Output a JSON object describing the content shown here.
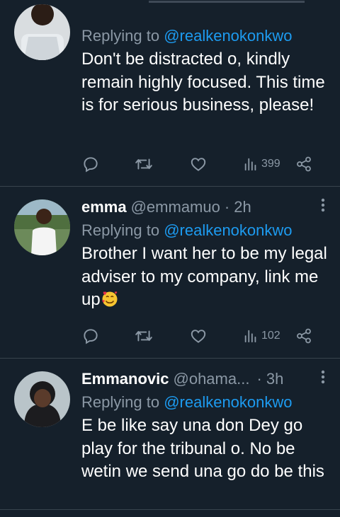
{
  "colors": {
    "background": "#15202b",
    "text_primary": "#ffffff",
    "text_secondary": "#8b98a5",
    "link": "#1d9bf0",
    "divider": "#38444d"
  },
  "tweets": [
    {
      "name": "",
      "handle": "",
      "time": "",
      "reply_prefix": "Replying to ",
      "reply_to": "@realkenokonkwo",
      "text": "Don't be distracted o, kindly remain highly focused. This time is for serious business, please!",
      "views": "399",
      "icons": [
        "reply-icon",
        "retweet-icon",
        "like-icon",
        "views-icon",
        "share-icon"
      ]
    },
    {
      "name": "emma",
      "handle": "@emmamuo",
      "time": "· 2h",
      "reply_prefix": "Replying to ",
      "reply_to": "@realkenokonkwo",
      "text": "Brother I want her to be my legal adviser to my company, link me up",
      "emoji": "smiling-face-with-hearts",
      "views": "102",
      "icons": [
        "reply-icon",
        "retweet-icon",
        "like-icon",
        "views-icon",
        "share-icon",
        "more-icon"
      ]
    },
    {
      "name": "Emmanovic",
      "handle": "@ohama...",
      "time": "· 3h",
      "reply_prefix": "Replying to ",
      "reply_to": "@realkenokonkwo",
      "text": "E be like say una don Dey go play for the tribunal o. No be wetin we send una go do be this",
      "icons": [
        "more-icon"
      ]
    }
  ]
}
